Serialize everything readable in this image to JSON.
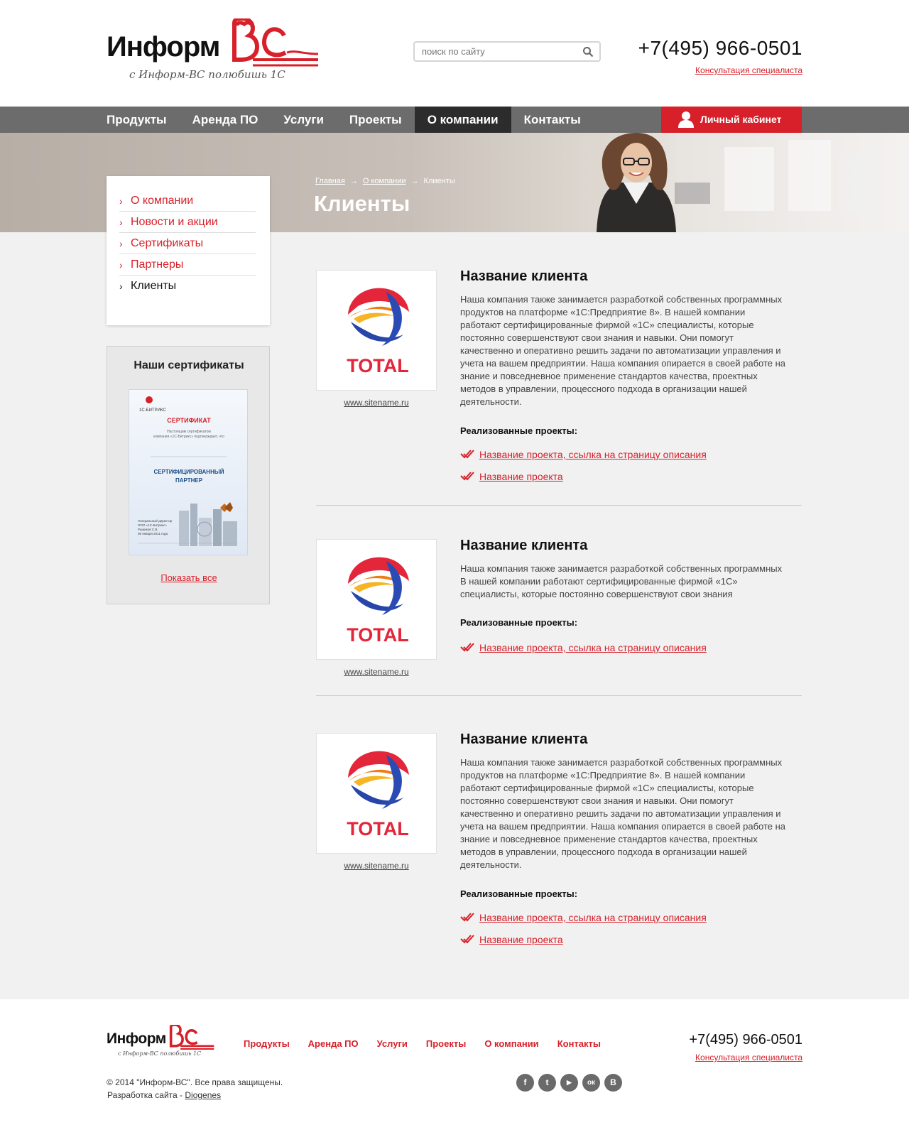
{
  "header": {
    "logo_text": "Информ",
    "logo_mark": "ВС",
    "slogan": "с Информ-ВС полюбишь 1С",
    "search_placeholder": "поиск по сайту",
    "phone": "+7(495) 966-0501",
    "consult_label": "Консультация специалиста"
  },
  "nav": {
    "items": [
      "Продукты",
      "Аренда ПО",
      "Услуги",
      "Проекты",
      "О компании",
      "Контакты"
    ],
    "active": "О компании",
    "cabinet_label": "Личный кабинет"
  },
  "breadcrumb": {
    "home": "Главная",
    "section": "О компании",
    "current": "Клиенты",
    "separator": "→"
  },
  "page_title": "Клиенты",
  "sidebar": {
    "menu": [
      "О компании",
      "Новости и акции",
      "Сертификаты",
      "Партнеры",
      "Клиенты"
    ],
    "certs_title": "Наши сертификаты",
    "cert": {
      "brand": "1С-БИТРИКС",
      "heading": "СЕРТИФИКАТ",
      "subtext": "Настоящим сертификатом компания «1С-Битрикс» подтверждает, что",
      "status": "СЕРТИФИЦИРОВАННЫЙ ПАРТНЕР"
    },
    "show_all": "Показать все"
  },
  "clients": [
    {
      "name": "Название клиента",
      "site": "www.sitename.ru",
      "logo_text": "TOTAL",
      "description": "Наша компания также занимается разработкой собственных программных  продуктов на платформе «1С:Предприятие 8». В нашей компании работают сертифицированные фирмой «1С» специалисты, которые постоянно совершенствуют свои знания и навыки. Они помогут качественно и оперативно решить задачи по автоматизации управления и учета на вашем предприятии. Наша компания опирается в своей работе на знание и повседневное применение стандартов качества, проектных методов в управлении, процессного подхода в организации нашей деятельности.",
      "projects_title": "Реализованные проекты:",
      "projects": [
        "Название проекта, ссылка на страницу описания",
        "Название проекта"
      ]
    },
    {
      "name": "Название клиента",
      "site": "www.sitename.ru",
      "logo_text": "TOTAL",
      "description": "Наша компания также занимается разработкой собственных программных В нашей компании работают сертифицированные фирмой «1С» специалисты, которые постоянно совершенствуют свои знания",
      "projects_title": "Реализованные проекты:",
      "projects": [
        "Название проекта, ссылка на страницу описания"
      ]
    },
    {
      "name": "Название клиента",
      "site": "www.sitename.ru",
      "logo_text": "TOTAL",
      "description": "Наша компания также занимается разработкой собственных программных  продуктов на платформе «1С:Предприятие 8». В нашей компании работают сертифицированные фирмой «1С» специалисты, которые постоянно совершенствуют свои знания и навыки. Они помогут качественно и оперативно решить задачи по автоматизации управления и учета на вашем предприятии. Наша компания опирается в своей работе на знание и повседневное применение стандартов качества, проектных методов в управлении, процессного подхода в организации нашей деятельности.",
      "projects_title": "Реализованные проекты:",
      "projects": [
        "Название проекта, ссылка на страницу описания",
        "Название проекта"
      ]
    }
  ],
  "footer": {
    "nav": [
      "Продукты",
      "Аренда ПО",
      "Услуги",
      "Проекты",
      "О компании",
      "Контакты"
    ],
    "phone": "+7(495) 966-0501",
    "consult_label": "Консультация специалиста",
    "copyright": "© 2014 \"Информ-ВС\". Все права защищены.",
    "dev_prefix": "Разработка сайта - ",
    "dev_name": "Diogenes",
    "socials": [
      {
        "icon": "facebook-icon",
        "glyph": "f"
      },
      {
        "icon": "twitter-icon",
        "glyph": "t"
      },
      {
        "icon": "youtube-icon",
        "glyph": "▶"
      },
      {
        "icon": "odnoklassniki-icon",
        "glyph": "ок"
      },
      {
        "icon": "vk-icon",
        "glyph": "B"
      }
    ]
  },
  "colors": {
    "brand_red": "#d8202a",
    "nav_gray": "#6c6c6c",
    "nav_active": "#2c2c2c",
    "content_bg": "#f1f1f1"
  }
}
